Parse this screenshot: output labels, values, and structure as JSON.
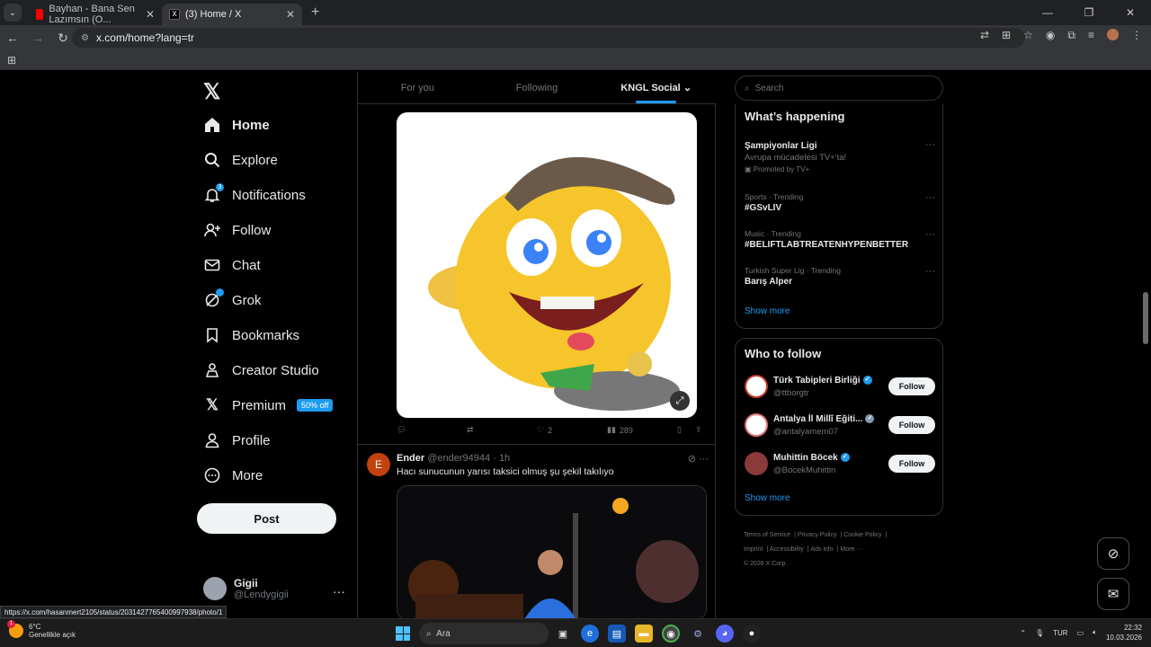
{
  "browser": {
    "tabs": [
      {
        "title": "Bayhan - Bana Sen Lazımsın (O..."
      },
      {
        "title": "(3) Home / X"
      }
    ],
    "url": "x.com/home?lang=tr",
    "status_url": "https://x.com/hasanmert2105/status/2031427765400997938/photo/1"
  },
  "sidebar": {
    "items": [
      {
        "label": "Home"
      },
      {
        "label": "Explore"
      },
      {
        "label": "Notifications",
        "badge": "3"
      },
      {
        "label": "Follow"
      },
      {
        "label": "Chat"
      },
      {
        "label": "Grok"
      },
      {
        "label": "Bookmarks"
      },
      {
        "label": "Creator Studio"
      },
      {
        "label": "Premium",
        "promo": "50% off"
      },
      {
        "label": "Profile"
      },
      {
        "label": "More"
      }
    ],
    "post_label": "Post",
    "account": {
      "name": "Gigii",
      "handle": "@Lendygigii"
    }
  },
  "feed": {
    "tabs": [
      "For you",
      "Following",
      "KNGL Social"
    ],
    "tweet1_actions": {
      "replies": "",
      "reposts": "",
      "likes": "2",
      "views": "289"
    },
    "tweet2": {
      "avatar_letter": "E",
      "name": "Ender",
      "handle": "@ender94944",
      "time": "1h",
      "text": "Hacı sunucunun yarısı taksici  olmuş şu şekil takılıyo"
    }
  },
  "right": {
    "search_placeholder": "Search",
    "whats_happening_title": "What’s happening",
    "trends": [
      {
        "meta": "",
        "name": "Şampiyonlar Ligi",
        "sub": "Avrupa mücadelesi TV+'ta!",
        "promo": "Promoted by TV+"
      },
      {
        "meta": "Sports · Trending",
        "name": "#GSvLIV"
      },
      {
        "meta": "Music · Trending",
        "name": "#BELIFTLABTREATENHYPENBETTER"
      },
      {
        "meta": "Turkish Super Lig · Trending",
        "name": "Barış Alper"
      }
    ],
    "show_more": "Show more",
    "who_to_follow_title": "Who to follow",
    "who": [
      {
        "name": "Türk Tabipleri Birliği",
        "handle": "@ttborgtr"
      },
      {
        "name": "Antalya İl Millî Eğiti...",
        "handle": "@antalyamem07"
      },
      {
        "name": "Muhittin Böcek",
        "handle": "@BocekMuhittin"
      }
    ],
    "follow_label": "Follow",
    "footer": [
      "Terms of Service",
      "Privacy Policy",
      "Cookie Policy",
      "Imprint",
      "Accessibility",
      "Ads info",
      "More ···",
      "© 2026 X Corp."
    ]
  },
  "taskbar": {
    "weather_temp": "6°C",
    "weather_desc": "Genellikle açık",
    "weather_badge": "1",
    "search_placeholder": "Ara",
    "lang": "TUR",
    "time": "22:32",
    "date": "10.03.2026"
  }
}
